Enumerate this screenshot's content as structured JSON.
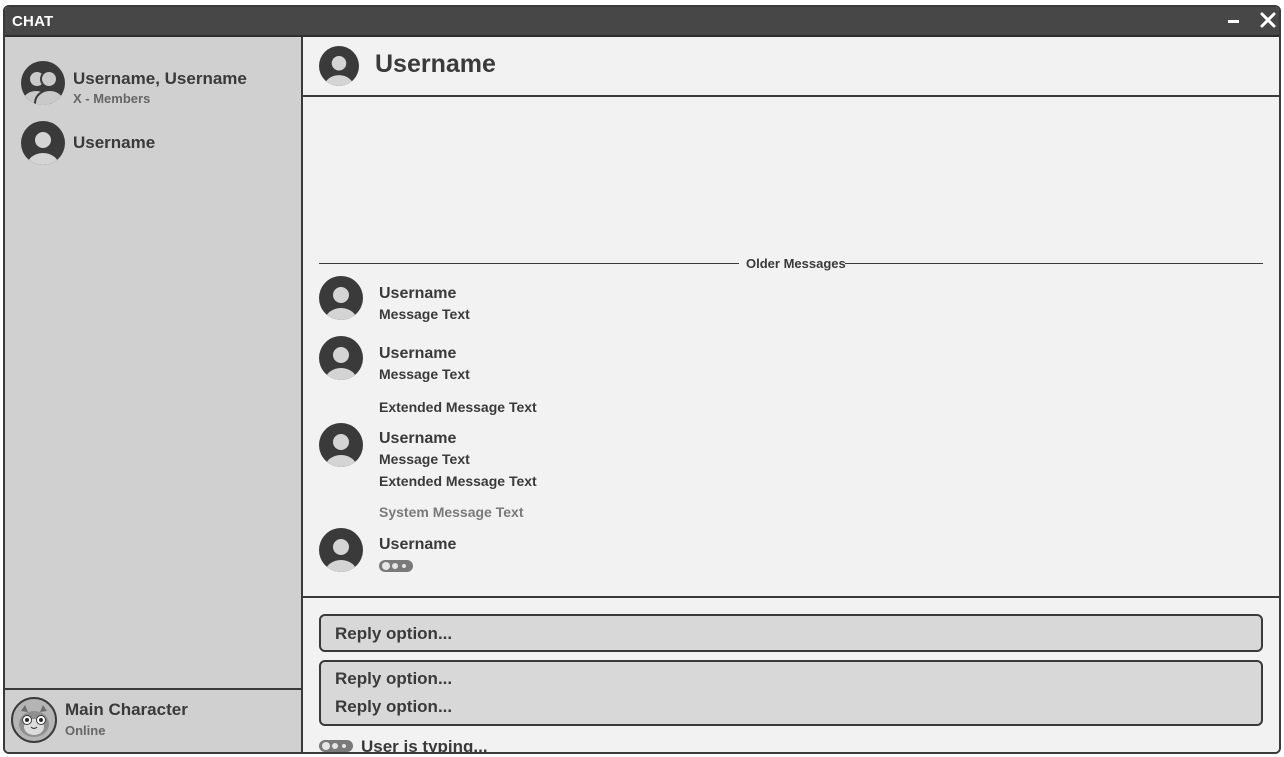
{
  "window": {
    "title": "CHAT"
  },
  "sidebar": {
    "conversations": [
      {
        "name": "Username, Username",
        "subtitle": "X - Members",
        "avatar_icon": "group-avatar-icon"
      },
      {
        "name": "Username",
        "avatar_icon": "user-avatar-icon"
      }
    ],
    "profile": {
      "name": "Main Character",
      "status": "Online",
      "avatar_icon": "character-avatar-icon"
    }
  },
  "header": {
    "name": "Username",
    "avatar_icon": "user-avatar-icon"
  },
  "messages": {
    "divider_label": "Older Messages",
    "items": [
      {
        "user": "Username",
        "text": "Message Text"
      },
      {
        "user": "Username",
        "text": "Message Text",
        "extended": "Extended Message Text"
      },
      {
        "user": "Username",
        "text": "Message Text",
        "extended": "Extended Message Text",
        "system": "System Message Text"
      },
      {
        "user": "Username",
        "typing": true
      }
    ]
  },
  "composer": {
    "options": [
      "Reply option...",
      "Reply option...",
      "Reply option..."
    ],
    "typing_status": "User is typing..."
  },
  "colors": {
    "titlebar": "#474747",
    "sidebar": "#d0d0d0",
    "main": "#f2f2f2",
    "avatar": "#3a3a3a",
    "reply_bg": "#d8d8d8"
  }
}
